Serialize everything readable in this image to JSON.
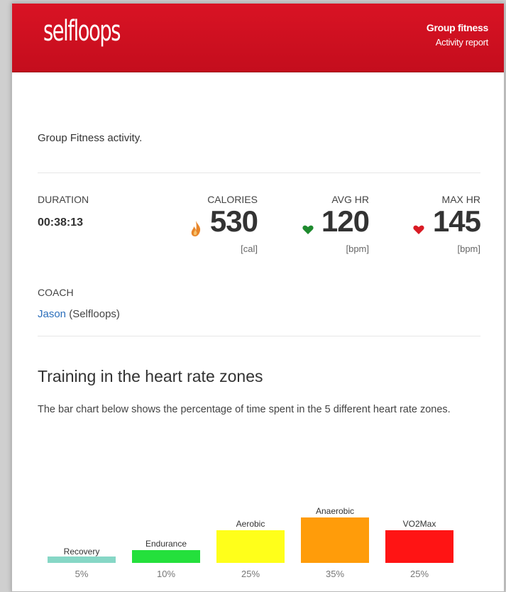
{
  "header": {
    "logo_text": "selfloops",
    "title": "Group fitness",
    "subtitle": "Activity report"
  },
  "intro_text": "Group Fitness activity.",
  "stats": {
    "duration": {
      "label": "DURATION",
      "value": "00:38:13"
    },
    "calories": {
      "label": "CALORIES",
      "value": "530",
      "unit": "[cal]",
      "icon": "flame-icon",
      "icon_color": "#e8862a"
    },
    "avg_hr": {
      "label": "AVG HR",
      "value": "120",
      "unit": "[bpm]",
      "icon": "heart-icon",
      "icon_color": "#1e8a2e"
    },
    "max_hr": {
      "label": "MAX HR",
      "value": "145",
      "unit": "[bpm]",
      "icon": "heart-icon",
      "icon_color": "#d91b24"
    }
  },
  "coach": {
    "label": "COACH",
    "name": "Jason",
    "org": "(Selfloops)"
  },
  "section": {
    "title": "Training in the heart rate zones",
    "description": "The bar chart below shows the percentage of time spent in the 5 different heart rate zones."
  },
  "chart_data": {
    "type": "bar",
    "categories": [
      "Recovery",
      "Endurance",
      "Aerobic",
      "Anaerobic",
      "VO2Max"
    ],
    "values": [
      5,
      10,
      25,
      35,
      25
    ],
    "value_labels": [
      "5%",
      "10%",
      "25%",
      "35%",
      "25%"
    ],
    "colors": [
      "#86d7c6",
      "#24e03c",
      "#ffff1a",
      "#ff9c0a",
      "#ff1414"
    ],
    "ylim": [
      0,
      35
    ]
  },
  "colors": {
    "brand_red": "#d91324",
    "link_blue": "#2a6ebb"
  }
}
